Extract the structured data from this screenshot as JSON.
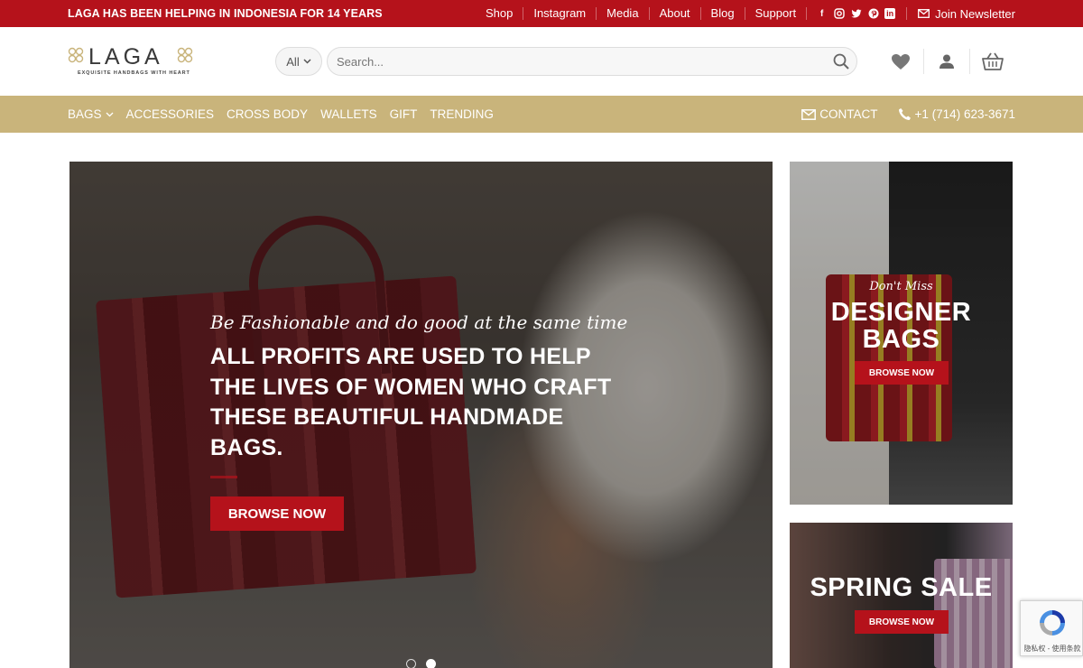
{
  "topbar": {
    "promo": "LAGA HAS BEEN HELPING IN INDONESIA FOR 14 YEARS",
    "links": [
      "Shop",
      "Instagram",
      "Media",
      "About",
      "Blog",
      "Support"
    ],
    "social_icons": [
      "facebook-icon",
      "instagram-icon",
      "twitter-icon",
      "pinterest-icon",
      "linkedin-icon"
    ],
    "newsletter": "Join Newsletter",
    "bg_color": "#b5121b"
  },
  "header": {
    "logo_word": "LAGA",
    "logo_tagline": "EXQUISITE HANDBAGS WITH HEART",
    "search_category": "All",
    "search_placeholder": "Search..."
  },
  "nav": {
    "items": [
      {
        "label": "BAGS",
        "has_dropdown": true
      },
      {
        "label": "ACCESSORIES"
      },
      {
        "label": "CROSS BODY"
      },
      {
        "label": "WALLETS"
      },
      {
        "label": "GIFT"
      },
      {
        "label": "TRENDING"
      }
    ],
    "contact": "CONTACT",
    "phone": "+1 (714) 623-3671",
    "bg_color": "#c9b47b"
  },
  "hero": {
    "script_text": "Be Fashionable and do good at the same time",
    "title": "ALL PROFITS ARE USED TO HELP THE LIVES OF WOMEN WHO CRAFT THESE BEAUTIFUL HANDMADE BAGS.",
    "button": "BROWSE NOW",
    "slides": 2,
    "active_slide": 2
  },
  "banners": [
    {
      "script": "Don't Miss",
      "title": "DESIGNER BAGS",
      "button": "BROWSE NOW"
    },
    {
      "title": "SPRING SALE",
      "button": "BROWSE NOW"
    }
  ],
  "recaptcha": {
    "text": "隐私权 - 使用条款"
  }
}
